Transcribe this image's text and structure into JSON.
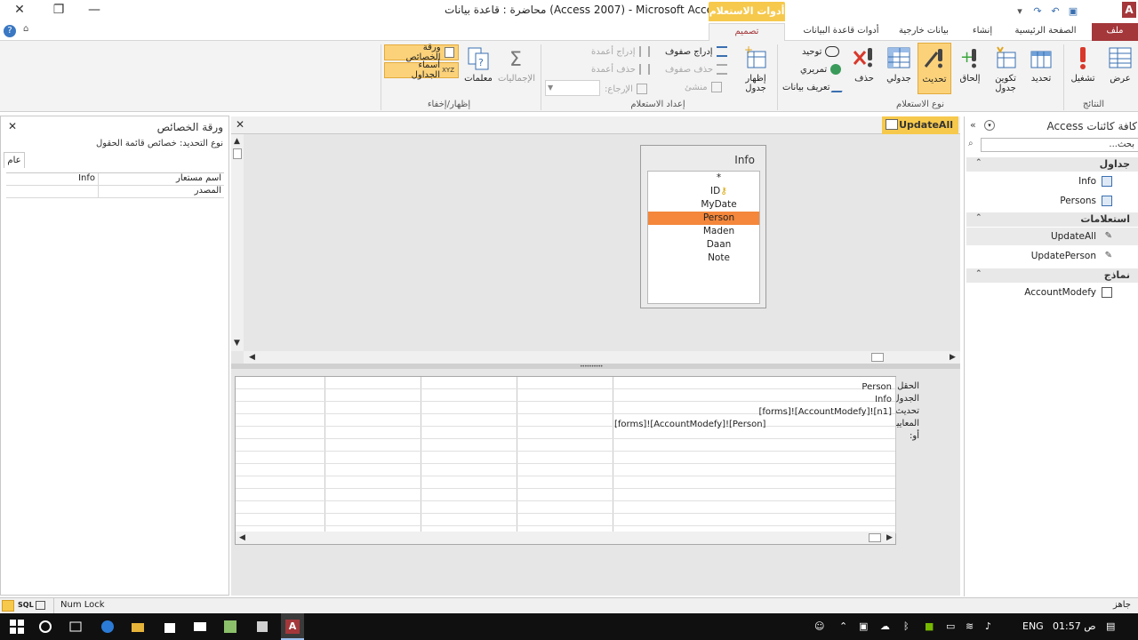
{
  "title_bar": {
    "title": "محاضرة : قاعدة بيانات (Access 2007) - Microsoft Access",
    "context_group": "أدوات الاستعلام",
    "app_icon": "A"
  },
  "tabs": {
    "file": "ملف",
    "home": "الصفحة الرئيسية",
    "create": "إنشاء",
    "external": "بيانات خارجية",
    "dbtools": "أدوات قاعدة البيانات",
    "design": "تصميم"
  },
  "ribbon": {
    "results": {
      "view": "عرض",
      "run": "تشغيل",
      "label": "النتائج"
    },
    "query_type": {
      "select": "تحديد",
      "make_table": "تكوين جدول",
      "append": "إلحاق",
      "update": "تحديث",
      "crosstab": "جدولي",
      "delete": "حذف",
      "union": "توحيد",
      "pass_through": "تمريري",
      "data_definition": "تعريف بيانات",
      "label": "نوع الاستعلام"
    },
    "query_setup": {
      "show_table": "إظهار جدول",
      "insert_rows": "إدراج صفوف",
      "delete_rows": "حذف صفوف",
      "builder": "منشئ",
      "insert_cols": "إدراج أعمدة",
      "delete_cols": "حذف أعمدة",
      "return": "الإرجاع:",
      "return_value": "",
      "label": "إعداد الاستعلام"
    },
    "show_hide": {
      "totals": "الإجماليات",
      "parameters": "معلمات",
      "property_sheet": "ورقة الخصائص",
      "table_names": "أسماء الجداول",
      "label": "إظهار/إخفاء"
    }
  },
  "property_sheet": {
    "title": "ورقة الخصائص",
    "selection_type": "نوع التحديد:  خصائص قائمة الحقول",
    "tab": "عام",
    "rows": [
      {
        "label": "اسم مستعار",
        "value": "Info"
      },
      {
        "label": "المصدر",
        "value": ""
      }
    ]
  },
  "document": {
    "tab_label": "UpdateAll",
    "table": {
      "name": "Info",
      "fields": [
        "*",
        "ID",
        "MyDate",
        "Person",
        "Maden",
        "Daan",
        "Note"
      ],
      "selected_field": "Person"
    },
    "grid": {
      "row_labels": [
        "الحقل:",
        "الجدول:",
        "تحديث إلى:",
        "المعايير:",
        "أو:"
      ],
      "column1": {
        "field": "Person",
        "table": "Info",
        "update_to": "[forms]![AccountModefy]![n1]",
        "criteria": "[forms]![AccountModefy]![Person]"
      }
    }
  },
  "nav_pane": {
    "title": "كافة كائنات Access",
    "search_placeholder": "بحث...",
    "sections": [
      {
        "title": "جداول",
        "items": [
          "Info",
          "Persons"
        ]
      },
      {
        "title": "استعلامات",
        "items": [
          "UpdateAll",
          "UpdatePerson"
        ]
      },
      {
        "title": "نماذج",
        "items": [
          "AccountModefy"
        ]
      }
    ]
  },
  "status_bar": {
    "ready": "جاهز",
    "num_lock": "Num Lock",
    "sql": "SQL"
  },
  "taskbar": {
    "time": "01:57",
    "ampm": "ص",
    "lang": "ENG",
    "app_letter": "A"
  },
  "colors": {
    "accent": "#a4373a",
    "context": "#f6c94c",
    "selected_field": "#f4873b"
  }
}
